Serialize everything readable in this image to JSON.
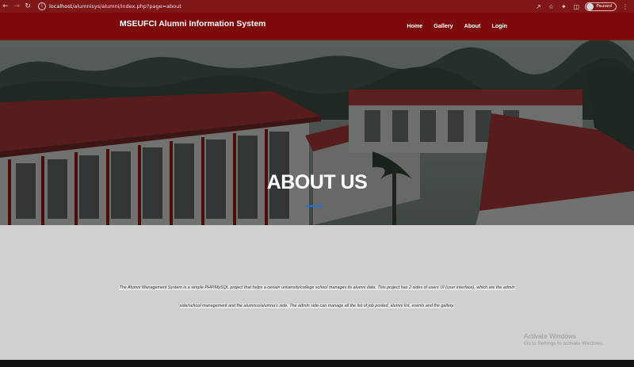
{
  "browser": {
    "url_host": "localhost",
    "url_path": "/alumnisys/alumni/index.php?page=about",
    "profile_status": "Paused"
  },
  "site": {
    "brand": "MSEUFCI Alumni Information System",
    "nav": [
      {
        "label": "Home"
      },
      {
        "label": "Gallery"
      },
      {
        "label": "About"
      },
      {
        "label": "Login"
      }
    ]
  },
  "hero": {
    "title": "ABOUT US",
    "accent_color": "#1e73d8"
  },
  "about": {
    "text": "The Alumni Management System is a simple PHP/MySQL project that helps a certain university/college school manages its alumni data. This project has 2 sides of users UI (user interface), which are the admin side/school management and the alumnus/alumna's side. The admin side can manage all the list of job posted, alumni list, events and the gallery."
  },
  "watermark": {
    "line1": "Activate Windows",
    "line2": "Go to Settings to activate Windows."
  },
  "colors": {
    "chrome": "#7f1617",
    "navbar": "#7c0a0a",
    "content_bg": "#d0d0d0"
  }
}
